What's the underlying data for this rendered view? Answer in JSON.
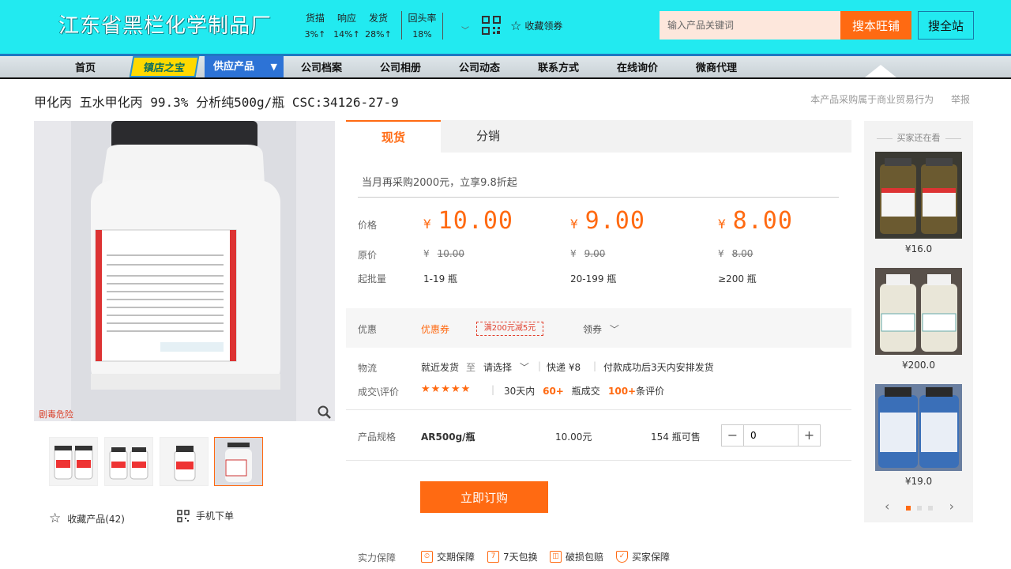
{
  "header": {
    "shop_name": "江东省黑栏化学制品厂",
    "stats": [
      {
        "label": "货描",
        "value": "3%↑"
      },
      {
        "label": "响应",
        "value": "14%↑"
      },
      {
        "label": "发货",
        "value": "28%↑"
      }
    ],
    "repeat_rate": {
      "label": "回头率",
      "value": "18%"
    },
    "favorite_shop": "收藏领券",
    "search_placeholder": "输入产品关键词",
    "search_shop_button": "搜本旺铺",
    "search_all_button": "搜全站"
  },
  "nav": {
    "home": "首页",
    "badge": "镇店之宝",
    "supply": "供应产品",
    "items": [
      "公司档案",
      "公司相册",
      "公司动态",
      "联系方式",
      "在线询价",
      "微商代理"
    ]
  },
  "product": {
    "title": "甲化丙  五水甲化丙  99.3% 分析纯500g/瓶  CSC:34126-27-9",
    "title_links": [
      "本产品采购属于商业贸易行为",
      "举报"
    ],
    "danger_label": "剧毒危险"
  },
  "gallery": {
    "favorite_label": "收藏产品(42)",
    "mobile_order": "手机下单"
  },
  "tabs": [
    "现货",
    "分销"
  ],
  "promo": "当月再采购2000元，立享9.8折起",
  "pricing": {
    "price_label": "价格",
    "orig_label": "原价",
    "moq_label": "起批量",
    "currency": "¥",
    "tiers": [
      {
        "price": "10.00",
        "original": "10.00",
        "moq": "1-19  瓶"
      },
      {
        "price": "9.00",
        "original": "9.00",
        "moq": "20-199  瓶"
      },
      {
        "price": "8.00",
        "original": "8.00",
        "moq": "≥200  瓶"
      }
    ]
  },
  "coupon": {
    "label": "优惠",
    "type": "优惠券",
    "tag": "满200元减5元",
    "get": "领券"
  },
  "logistics": {
    "label": "物流",
    "ship_from": "就近发货",
    "to": "至",
    "select": "请选择",
    "express": "快递 ¥8",
    "note": "付款成功后3天内安排发货"
  },
  "deals": {
    "label": "成交\\评价",
    "stars": "★★★★★",
    "days": "30天内",
    "count": "60+",
    "count_unit": "瓶成交",
    "reviews": "100+",
    "reviews_unit": "条评价"
  },
  "spec": {
    "label": "产品规格",
    "name": "AR500g/瓶",
    "price": "10.00元",
    "stock": "154 瓶可售",
    "qty": "0"
  },
  "buy_button": "立即订购",
  "guarantee": {
    "label": "实力保障",
    "items": [
      "交期保障",
      "7天包换",
      "破损包赔",
      "买家保障"
    ]
  },
  "sidebar": {
    "title": "买家还在看",
    "items": [
      {
        "price": "¥16.0"
      },
      {
        "price": "¥200.0"
      },
      {
        "price": "¥19.0"
      }
    ]
  },
  "colors": {
    "accent": "#ff6a12",
    "header_bg": "#22eaf0",
    "nav_blue": "#2d73d6"
  }
}
